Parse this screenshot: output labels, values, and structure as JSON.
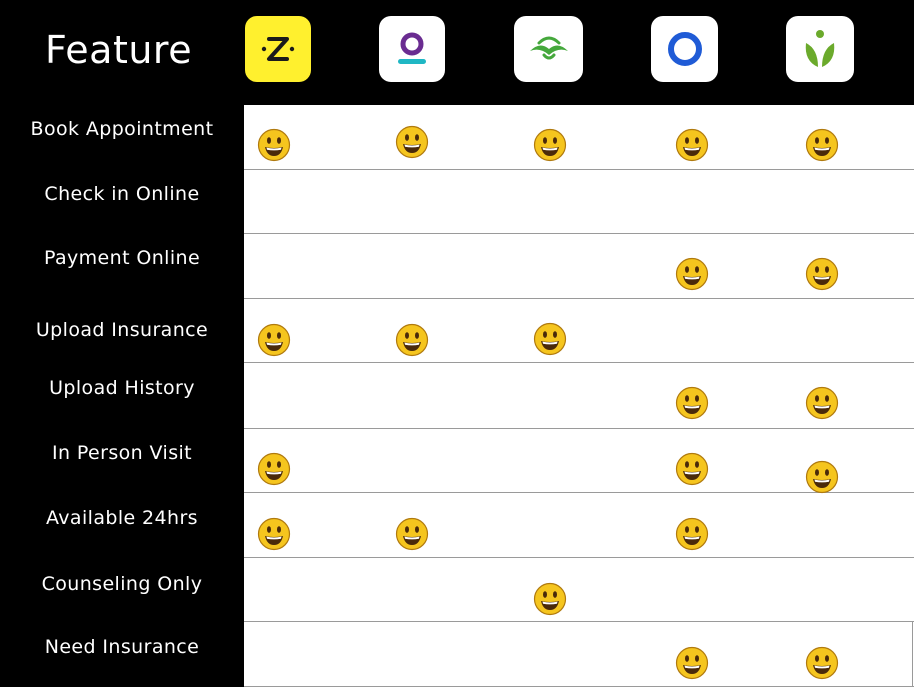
{
  "header": {
    "title": "Feature"
  },
  "apps": [
    {
      "icon": "zocdoc-icon",
      "bg": "#FFF02E",
      "fg": "#1B1B1B"
    },
    {
      "icon": "purple-ring-icon",
      "bg": "#FFFFFF",
      "fg": "#6A2C91",
      "accent": "#1FB7C4"
    },
    {
      "icon": "green-hands-icon",
      "bg": "#FFFFFF",
      "fg": "#45A83C"
    },
    {
      "icon": "blue-ring-icon",
      "bg": "#FFFFFF",
      "fg": "#1F5BD6"
    },
    {
      "icon": "green-sprout-icon",
      "bg": "#FFFFFF",
      "fg": "#6BAA2C"
    }
  ],
  "features": [
    {
      "label": "Book Appointment",
      "supported": [
        true,
        true,
        true,
        true,
        true
      ]
    },
    {
      "label": "Check in Online",
      "supported": [
        false,
        false,
        false,
        false,
        false
      ]
    },
    {
      "label": "Payment Online",
      "supported": [
        false,
        false,
        false,
        true,
        true
      ]
    },
    {
      "label": "Upload Insurance",
      "supported": [
        true,
        true,
        true,
        false,
        false
      ]
    },
    {
      "label": "Upload History",
      "supported": [
        false,
        false,
        false,
        true,
        true
      ]
    },
    {
      "label": "In Person Visit",
      "supported": [
        true,
        false,
        false,
        true,
        true
      ]
    },
    {
      "label": "Available 24hrs",
      "supported": [
        true,
        true,
        false,
        true,
        false
      ]
    },
    {
      "label": "Counseling Only",
      "supported": [
        false,
        false,
        true,
        false,
        false
      ]
    },
    {
      "label": "Need Insurance",
      "supported": [
        false,
        false,
        false,
        true,
        true
      ]
    }
  ],
  "mark": {
    "icon": "smiley-face-icon",
    "face": "#F5C51E",
    "outline": "#B07A0E",
    "feature": "#4A2A0A"
  }
}
